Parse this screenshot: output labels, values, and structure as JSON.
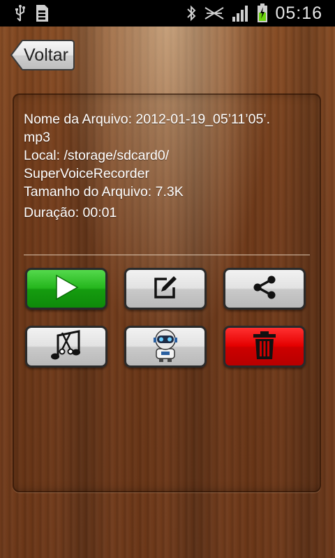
{
  "status_bar": {
    "time": "05:16",
    "icons": [
      "usb-icon",
      "sd-card-icon",
      "bluetooth-icon",
      "no-signal-icon",
      "signal-bars-icon",
      "battery-charging-icon"
    ]
  },
  "header": {
    "back_label": "Voltar"
  },
  "file_info": {
    "name_line1": "Nome da Arquivo: 2012-01-19_05’11’05’.",
    "name_line2": "mp3",
    "location_line1": "Local: /storage/sdcard0/",
    "location_line2": "SuperVoiceRecorder",
    "size": "Tamanho do Arquivo: 7.3K",
    "duration": "Duração: 00:01"
  },
  "actions": [
    {
      "name": "play",
      "icon": "play-icon",
      "color": "#1fae18"
    },
    {
      "name": "rename",
      "icon": "edit-icon",
      "color": "#d6d6d6"
    },
    {
      "name": "share",
      "icon": "share-icon",
      "color": "#d6d6d6"
    },
    {
      "name": "ringtone-cut",
      "icon": "music-scissors-icon",
      "color": "#d6d6d6"
    },
    {
      "name": "robot-voice",
      "icon": "robot-icon",
      "color": "#d6d6d6"
    },
    {
      "name": "delete",
      "icon": "trash-icon",
      "color": "#e00000"
    }
  ]
}
